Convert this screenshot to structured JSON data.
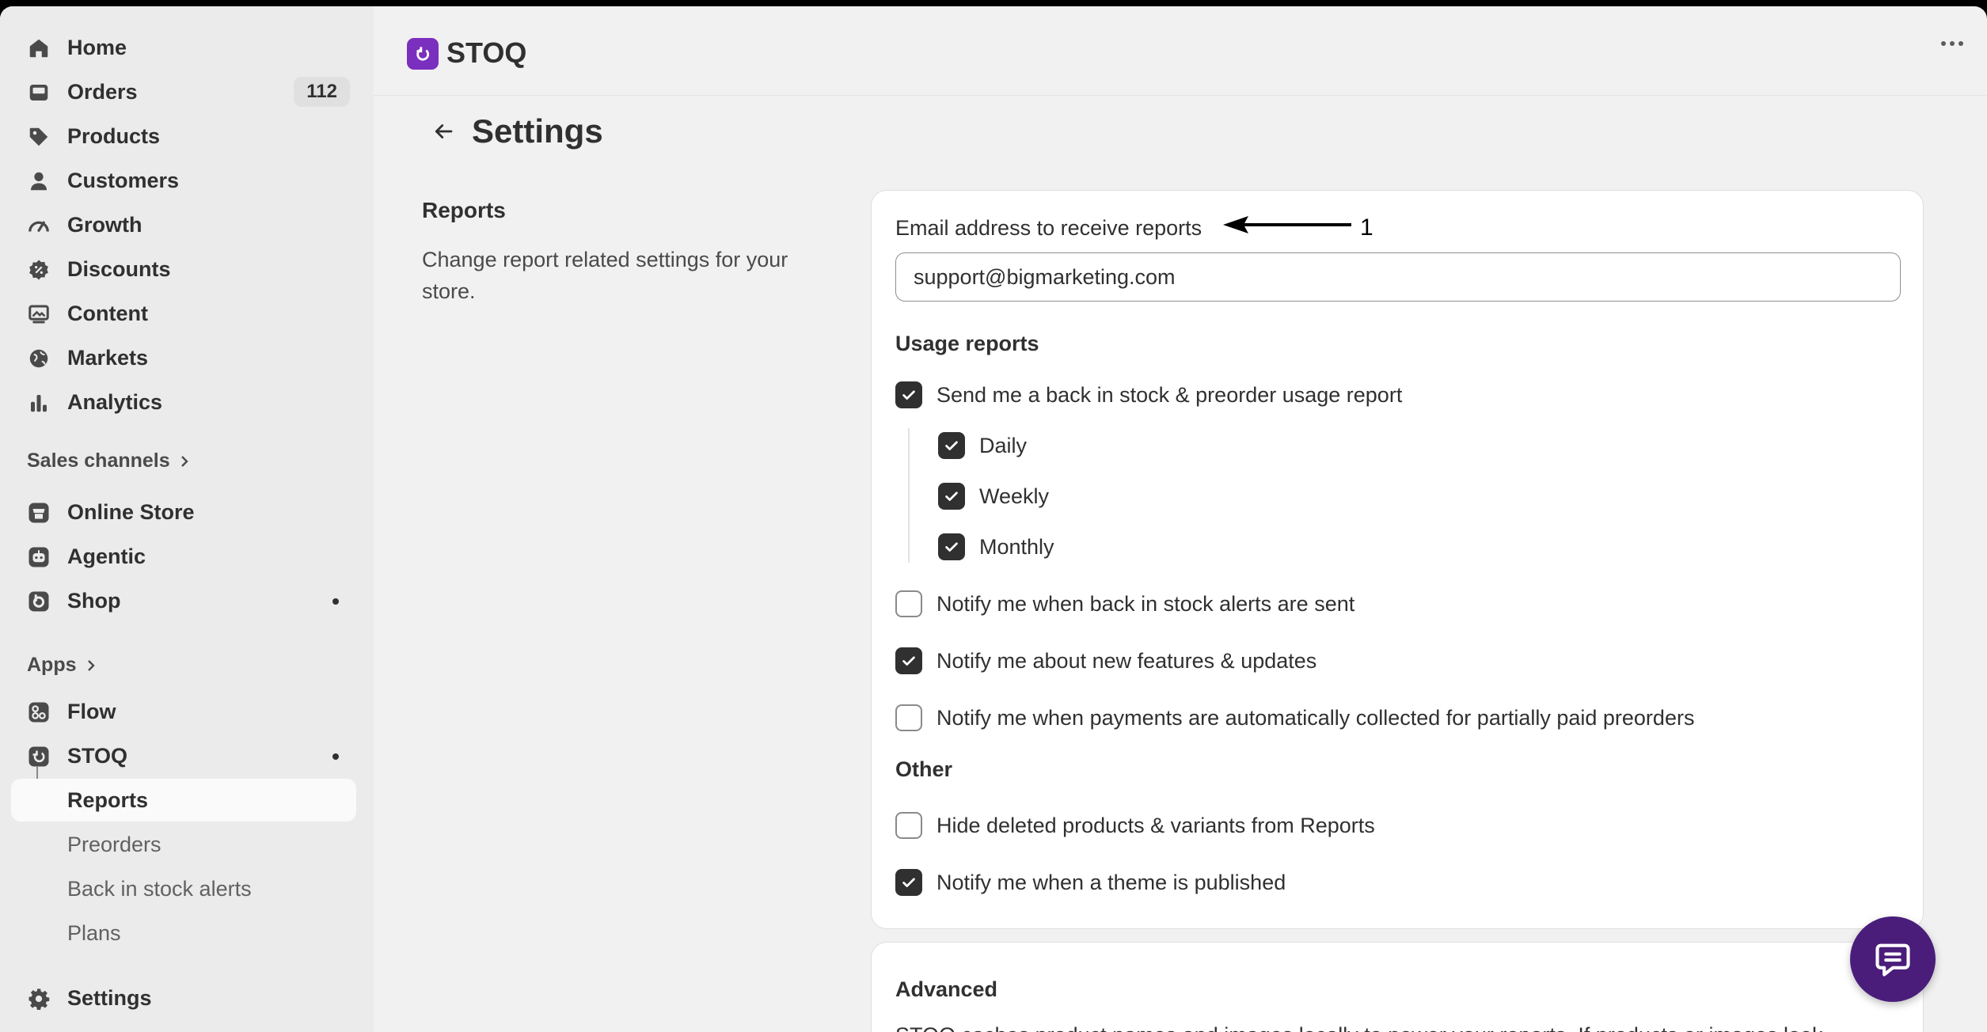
{
  "sidebar": {
    "main_items": [
      {
        "label": "Home",
        "icon": "home-icon"
      },
      {
        "label": "Orders",
        "icon": "inbox-icon",
        "badge": "112"
      },
      {
        "label": "Products",
        "icon": "tag-icon"
      },
      {
        "label": "Customers",
        "icon": "person-icon"
      },
      {
        "label": "Growth",
        "icon": "gauge-icon"
      },
      {
        "label": "Discounts",
        "icon": "discount-icon"
      },
      {
        "label": "Content",
        "icon": "image-icon"
      },
      {
        "label": "Markets",
        "icon": "globe-icon"
      },
      {
        "label": "Analytics",
        "icon": "bar-chart-icon"
      }
    ],
    "sales_channels": {
      "heading": "Sales channels",
      "items": [
        {
          "label": "Online Store",
          "icon": "store-icon"
        },
        {
          "label": "Agentic",
          "icon": "robot-icon"
        },
        {
          "label": "Shop",
          "icon": "shop-icon"
        }
      ]
    },
    "apps": {
      "heading": "Apps",
      "items": [
        {
          "label": "Flow",
          "icon": "flow-icon"
        },
        {
          "label": "STOQ",
          "icon": "stoq-icon"
        }
      ],
      "sub_items": [
        {
          "label": "Reports",
          "active": true
        },
        {
          "label": "Preorders"
        },
        {
          "label": "Back in stock alerts"
        },
        {
          "label": "Plans"
        }
      ]
    },
    "settings": {
      "label": "Settings",
      "icon": "gear-icon"
    }
  },
  "topbar": {
    "app_title": "STOQ"
  },
  "page": {
    "title": "Settings",
    "section_title": "Reports",
    "section_description": "Change report related settings for your store."
  },
  "reports_card": {
    "email_label": "Email address to receive reports",
    "annotation": "1",
    "email_value": "support@bigmarketing.com",
    "usage_heading": "Usage reports",
    "usage_main": {
      "label": "Send me a back in stock & preorder usage report",
      "checked": true
    },
    "frequency": [
      {
        "label": "Daily",
        "checked": true
      },
      {
        "label": "Weekly",
        "checked": true
      },
      {
        "label": "Monthly",
        "checked": true
      }
    ],
    "notify": [
      {
        "label": "Notify me when back in stock alerts are sent",
        "checked": false
      },
      {
        "label": "Notify me about new features & updates",
        "checked": true
      },
      {
        "label": "Notify me when payments are automatically collected for partially paid preorders",
        "checked": false
      }
    ],
    "other_heading": "Other",
    "other": [
      {
        "label": "Hide deleted products & variants from Reports",
        "checked": false
      },
      {
        "label": "Notify me when a theme is published",
        "checked": true
      }
    ]
  },
  "advanced_card": {
    "heading": "Advanced",
    "text": "STOQ caches product names and images locally to power your reports. If products or images look"
  },
  "colors": {
    "accent": "#7b2fbe",
    "chat_button": "#4a1d7a",
    "checkbox_checked": "#303030"
  }
}
